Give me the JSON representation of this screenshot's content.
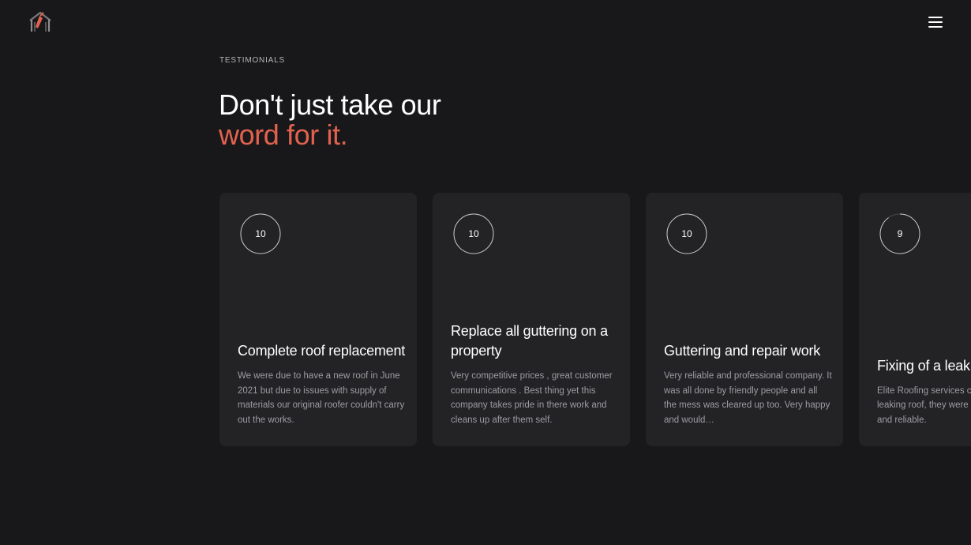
{
  "header": {
    "logo_icon": "house-logo-icon",
    "menu_icon": "hamburger-menu-icon"
  },
  "section": {
    "eyebrow": "TESTIMONIALS",
    "headline_line1": "Don't just take our",
    "headline_line2": "word for it.",
    "accent_color": "#e2624f"
  },
  "testimonials": [
    {
      "score": "10",
      "rating": 1.0,
      "title": "Complete roof replacement",
      "text": "We were due to have a new roof in June 2021 but due to issues with supply of materials our original roofer couldn't carry out the works."
    },
    {
      "score": "10",
      "rating": 1.0,
      "title": "Replace all guttering on a property",
      "text": "Very competitive prices , great customer communications . Best thing yet this company takes pride in there work and cleans up after them self."
    },
    {
      "score": "10",
      "rating": 1.0,
      "title": "Guttering and repair work",
      "text": "Very reliable and professional company. It was all done by friendly people and all the mess was cleared up too. Very happy and would…"
    },
    {
      "score": "9",
      "rating": 0.9,
      "title": "Fixing of a leaking roof",
      "text": "Elite Roofing services came to fix my leaking roof, they were very professional and reliable."
    }
  ]
}
